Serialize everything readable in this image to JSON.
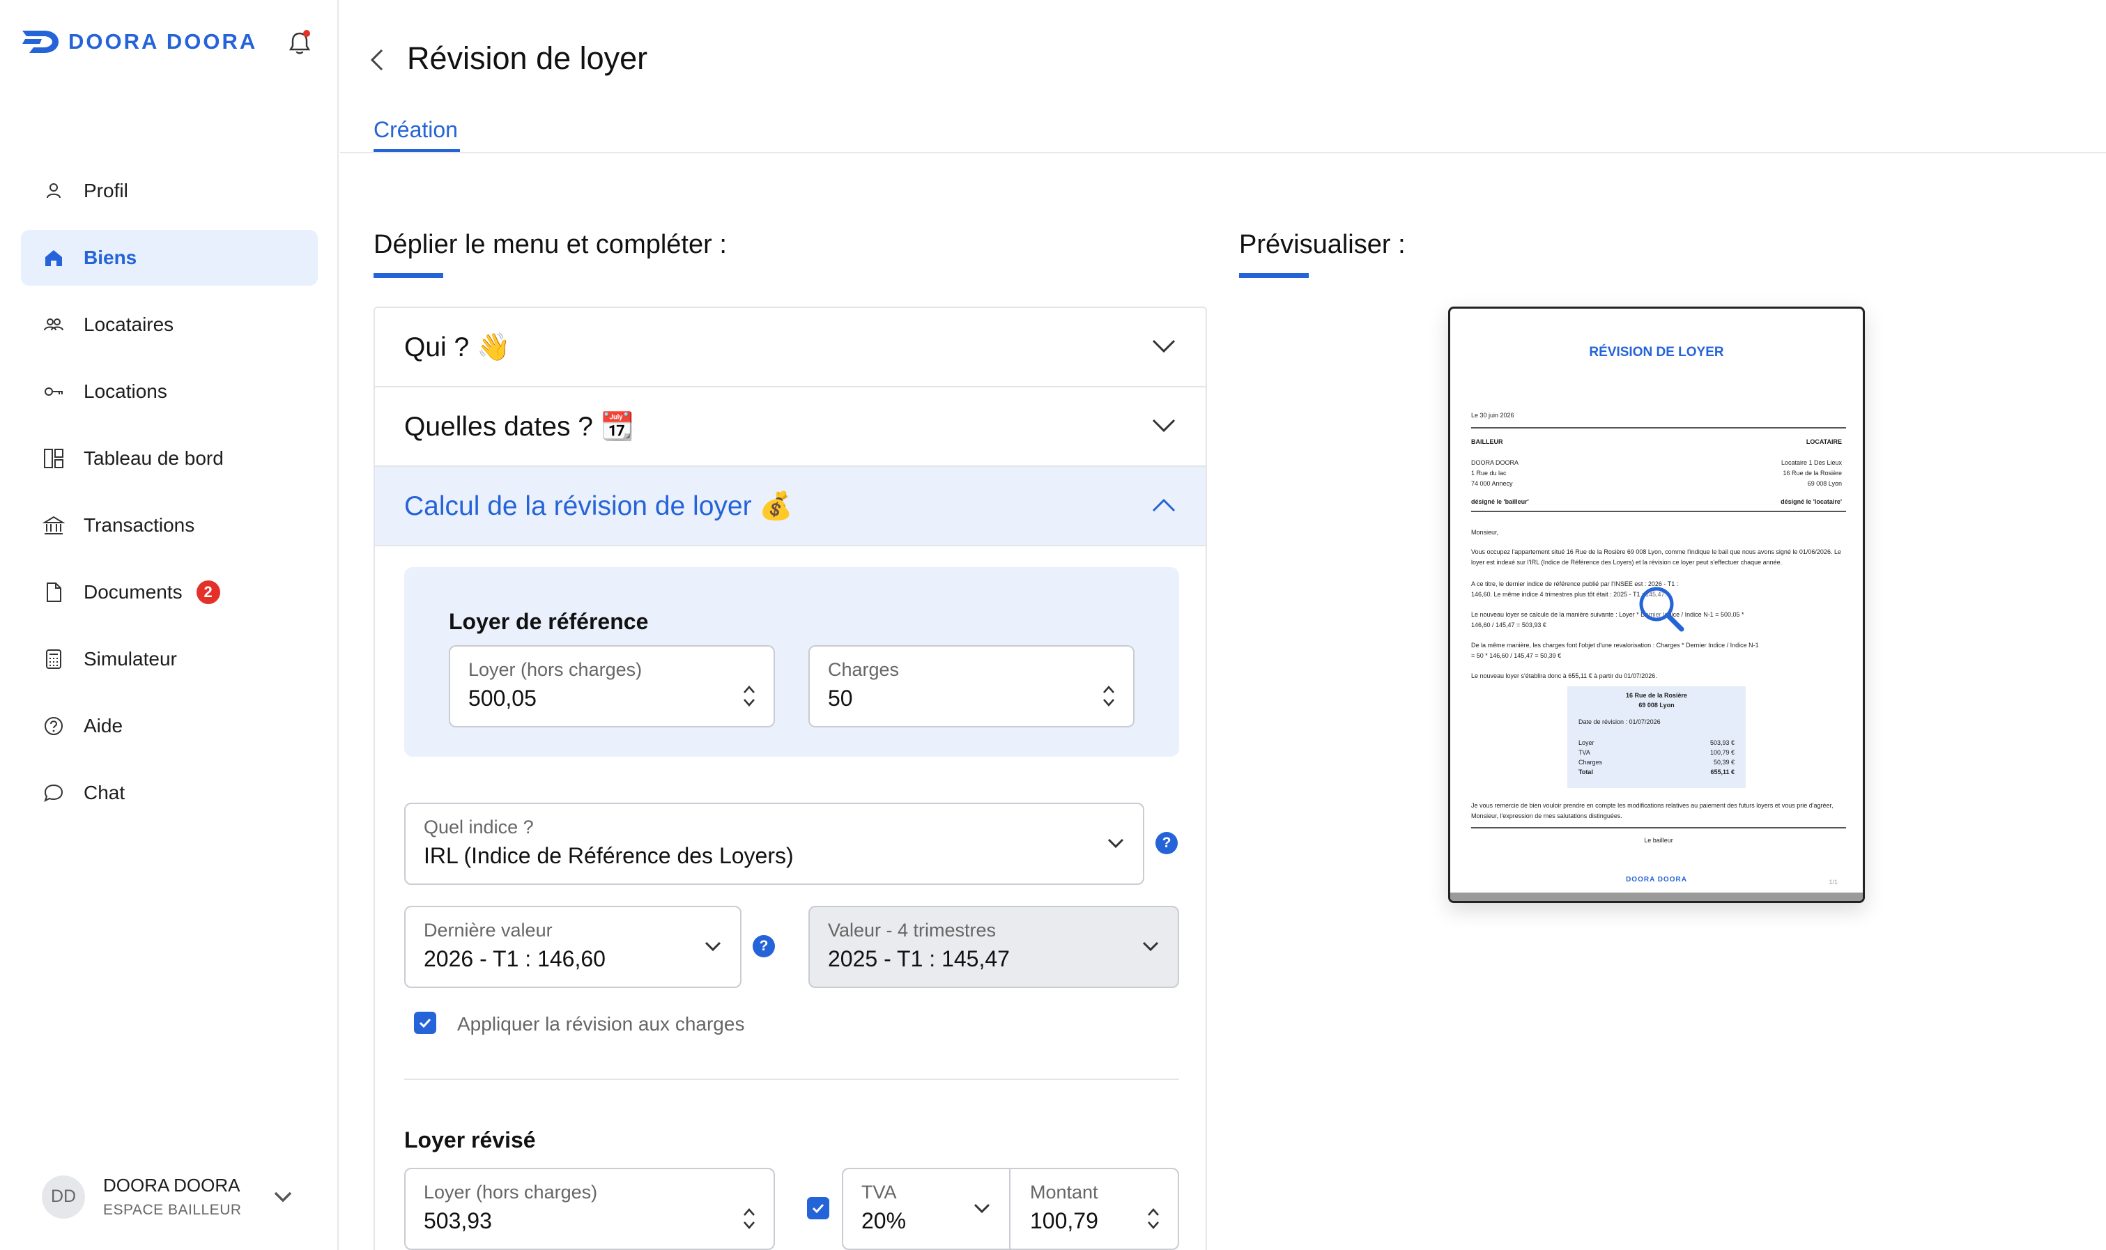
{
  "brand": {
    "name": "DOORA DOORA"
  },
  "colors": {
    "accent": "#2563d8",
    "badge": "#e5302a",
    "active_bg": "#e8f0fd"
  },
  "sidebar": {
    "items": [
      {
        "label": "Profil",
        "icon": "user-icon"
      },
      {
        "label": "Biens",
        "icon": "home-icon",
        "active": true
      },
      {
        "label": "Locataires",
        "icon": "people-icon"
      },
      {
        "label": "Locations",
        "icon": "key-icon"
      },
      {
        "label": "Tableau de bord",
        "icon": "dashboard-icon"
      },
      {
        "label": "Transactions",
        "icon": "bank-icon"
      },
      {
        "label": "Documents",
        "icon": "document-icon",
        "badge": "2"
      },
      {
        "label": "Simulateur",
        "icon": "calculator-icon"
      },
      {
        "label": "Aide",
        "icon": "help-icon"
      },
      {
        "label": "Chat",
        "icon": "chat-icon"
      }
    ]
  },
  "user": {
    "initials": "DD",
    "name": "DOORA DOORA",
    "role": "ESPACE BAILLEUR"
  },
  "header": {
    "title": "Révision de loyer",
    "tab": "Création"
  },
  "form": {
    "title": "Déplier le menu et compléter :",
    "sections": [
      {
        "label": "Qui ? 👋"
      },
      {
        "label": "Quelles dates ? 📆"
      },
      {
        "label": "Calcul de la révision de loyer 💰"
      }
    ],
    "reference": {
      "title": "Loyer de référence",
      "rent_label": "Loyer (hors charges)",
      "rent_value": "500,05",
      "charges_label": "Charges",
      "charges_value": "50"
    },
    "index": {
      "label": "Quel indice ?",
      "value": "IRL (Indice de Référence des Loyers)"
    },
    "last_value": {
      "label": "Dernière valeur",
      "value": "2026 - T1 : 146,60"
    },
    "previous_value": {
      "label": "Valeur - 4 trimestres",
      "value": "2025 - T1 : 145,47"
    },
    "apply_charges": {
      "label": "Appliquer la révision aux charges",
      "checked": true
    },
    "revised": {
      "title": "Loyer révisé",
      "rent_label": "Loyer (hors charges)",
      "rent_value": "503,93",
      "tva_label": "TVA",
      "tva_value": "20%",
      "amount_label": "Montant",
      "amount_value": "100,79"
    },
    "help_glyph": "?"
  },
  "preview": {
    "title": "Prévisualiser :",
    "doc": {
      "title": "RÉVISION DE LOYER",
      "date": "Le 30 juin 2026",
      "bailleur_head": "BAILLEUR",
      "locataire_head": "LOCATAIRE",
      "bailleur_lines": [
        "DOORA DOORA",
        "1 Rue du lac",
        "74 000 Annecy"
      ],
      "locataire_lines": [
        "Locataire 1 Des Lieux",
        "16 Rue de la Rosière",
        "69 008 Lyon"
      ],
      "bailleur_note": "désigné le 'bailleur'",
      "locataire_note": "désigné le 'locataire'",
      "salutation": "Monsieur,",
      "para1": "Vous occupez l'appartement situé 16 Rue de la Rosière 69 008 Lyon, comme l'indique le bail que nous avons signé le 01/06/2026. Le loyer est indexé sur l'IRL (Indice de Référence des Loyers) et la révision ce loyer peut s'effectuer chaque année.",
      "para2": "A ce titre, le dernier indice de référence publié par l'INSEE est : 2026 - T1 : 146,60. Le même indice 4 trimestres plus tôt était : 2025 - T1 : 145,47.",
      "para3": "Le nouveau loyer se calcule de la manière suivante : Loyer * Dernier Indice / Indice N-1 = 500,05 * 146,60 / 145,47 = 503,93 €",
      "para4": "De la même manière, les charges font l'objet d'une revalorisation : Charges * Dernier Indice / Indice N-1 = 50 * 146,60 / 145,47 = 50,39 €",
      "para5": "Le nouveau loyer s'établira donc à 655,11 € à partir du 01/07/2026.",
      "table_address": "16 Rue de la Rosière",
      "table_city": "69 008 Lyon",
      "table_date": "Date de révision : 01/07/2026",
      "table_rows": [
        {
          "label": "Loyer",
          "value": "503,93 €"
        },
        {
          "label": "TVA",
          "value": "100,79 €"
        },
        {
          "label": "Charges",
          "value": "50,39 €"
        },
        {
          "label": "Total",
          "value": "655,11 €"
        }
      ],
      "closing": "Je vous remercie de bien vouloir prendre en compte les modifications relatives au paiement des futurs loyers et vous prie d'agréer, Monsieur, l'expression de mes salutations distinguées.",
      "signature": "Le bailleur",
      "logo": "DOORA DOORA",
      "page": "1/1"
    }
  }
}
